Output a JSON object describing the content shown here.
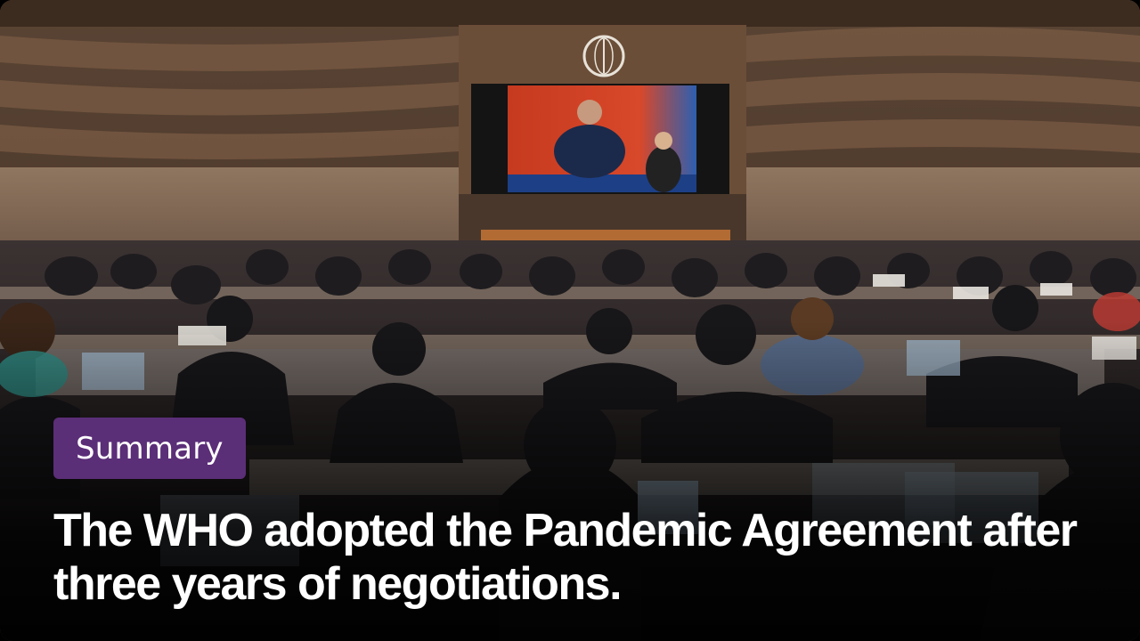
{
  "tag": {
    "label": "Summary",
    "color": "#5b2e78"
  },
  "headline": "The WHO adopted the Pandemic Agreement after three years of negotiations."
}
